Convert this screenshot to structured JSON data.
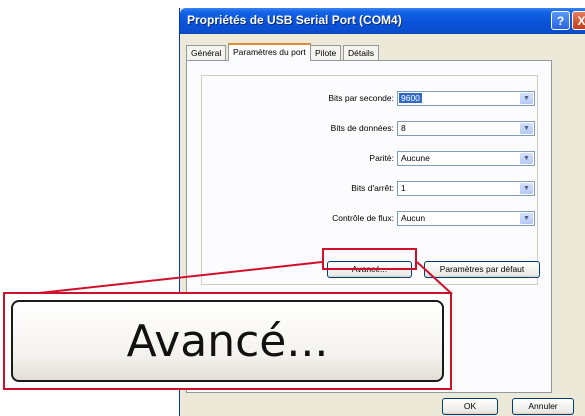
{
  "window": {
    "title": "Propriétés de USB Serial Port (COM4)",
    "help_glyph": "?",
    "close_glyph": "X"
  },
  "tabs": [
    {
      "label": "Général",
      "active": false
    },
    {
      "label": "Paramètres du port",
      "active": true
    },
    {
      "label": "Pilote",
      "active": false
    },
    {
      "label": "Détails",
      "active": false
    }
  ],
  "settings": [
    {
      "label": "Bits par seconde:",
      "value": "9600"
    },
    {
      "label": "Bits de données:",
      "value": "8"
    },
    {
      "label": "Parité:",
      "value": "Aucune"
    },
    {
      "label": "Bits d'arrêt:",
      "value": "1"
    },
    {
      "label": "Contrôle de flux:",
      "value": "Aucun"
    }
  ],
  "buttons": {
    "advanced": "Avancé...",
    "defaults": "Paramètres par défaut",
    "ok": "OK",
    "cancel": "Annuler"
  },
  "callout": {
    "zoom_label": "Avancé...",
    "highlight_color": "#d0102a"
  },
  "icons": {
    "dropdown": "chevron-down-icon"
  }
}
